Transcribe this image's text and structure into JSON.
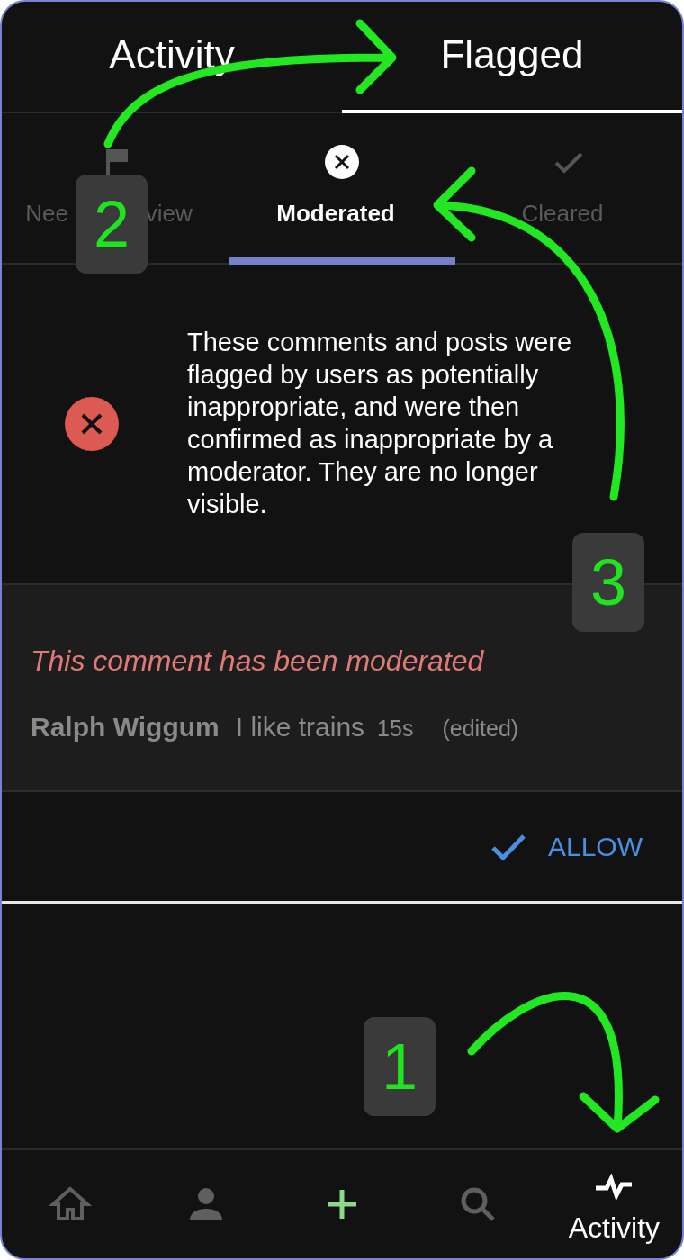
{
  "top_tabs": [
    {
      "label": "Activity",
      "selected": false
    },
    {
      "label": "Flagged",
      "selected": true
    }
  ],
  "sub_tabs": [
    {
      "label_parts": [
        "Nee",
        "view"
      ],
      "kind": "flag",
      "selected": false
    },
    {
      "label": "Moderated",
      "kind": "cross",
      "selected": true
    },
    {
      "label": "Cleared",
      "kind": "check",
      "selected": false
    }
  ],
  "info": {
    "text": "These comments and posts were flagged by users as potentially inappropriate, and were then confirmed as inappropriate by a moderator. They are no longer visible."
  },
  "comment": {
    "notice": "This comment has been moderated",
    "author": "Ralph Wiggum",
    "body": "I like trains",
    "time": "15s",
    "edited": "(edited)"
  },
  "actions": [
    {
      "label": "ALLOW"
    }
  ],
  "bottom_nav": [
    {
      "kind": "home",
      "selected": false
    },
    {
      "kind": "profile",
      "selected": false
    },
    {
      "kind": "add",
      "selected": false
    },
    {
      "kind": "search",
      "selected": false
    },
    {
      "kind": "activity",
      "label": "Activity",
      "selected": true
    }
  ],
  "annotations": [
    {
      "number": "2",
      "kind": "top"
    },
    {
      "number": "3",
      "kind": "middle"
    },
    {
      "number": "1",
      "kind": "bottom"
    }
  ]
}
